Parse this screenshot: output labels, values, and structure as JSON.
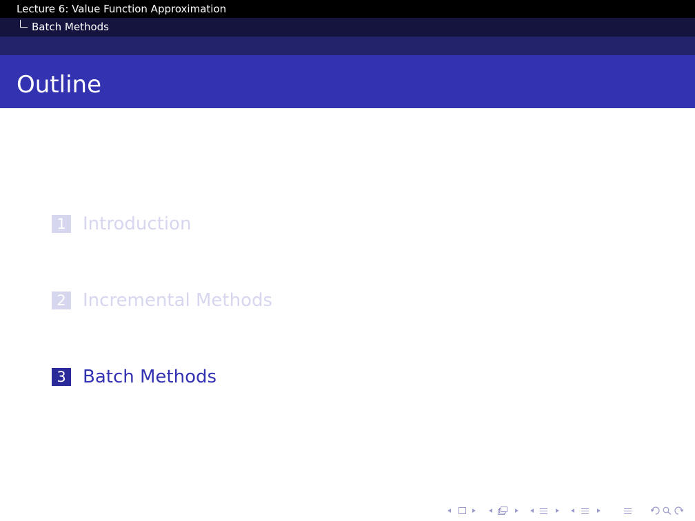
{
  "header": {
    "lecture_title": "Lecture 6: Value Function Approximation",
    "section": "Batch Methods"
  },
  "frame": {
    "title": "Outline"
  },
  "outline": {
    "items": [
      {
        "number": "1",
        "label": "Introduction",
        "state": "shaded"
      },
      {
        "number": "2",
        "label": "Incremental Methods",
        "state": "shaded"
      },
      {
        "number": "3",
        "label": "Batch Methods",
        "state": "current"
      }
    ]
  },
  "navigation": {
    "icons": [
      "slide-nav",
      "frame-nav",
      "subsection-nav",
      "section-nav",
      "document-nav",
      "search-nav"
    ]
  },
  "colors": {
    "header_black": "#000000",
    "header_section": "#14143f",
    "title_band": "#3333b2",
    "shaded": "#d6d6ef",
    "accent": "#3333b2"
  }
}
